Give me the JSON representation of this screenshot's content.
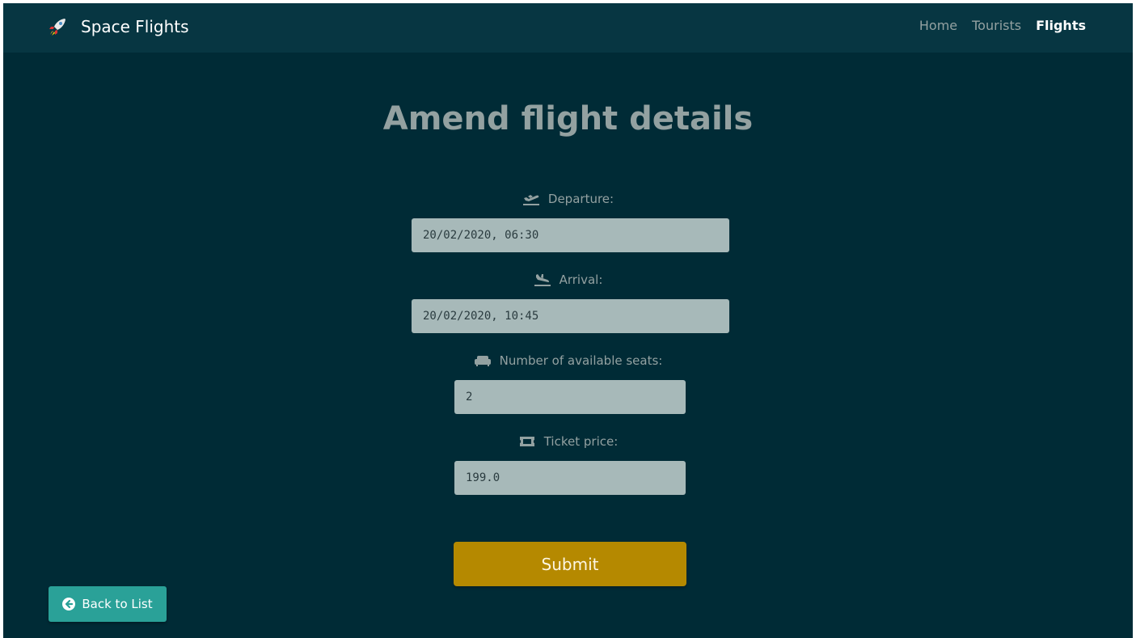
{
  "navbar": {
    "brand": "Space Flights",
    "brand_icon": "rocket-icon",
    "links": [
      "Home",
      "Tourists",
      "Flights"
    ],
    "active_link": "Flights"
  },
  "form": {
    "title": "Amend flight details",
    "departure": {
      "label": "Departure:",
      "value": "20/02/2020, 06:30",
      "icon": "plane-departure-icon"
    },
    "arrival": {
      "label": "Arrival:",
      "value": "20/02/2020, 10:45",
      "icon": "plane-arrival-icon"
    },
    "seats": {
      "label": "Number of available seats:",
      "value": "2",
      "icon": "couch-icon"
    },
    "price": {
      "label": "Ticket price:",
      "value": "199.0",
      "icon": "ticket-icon"
    },
    "submit_label": "Submit"
  },
  "back_button": {
    "label": "Back to List",
    "icon": "arrow-circle-left-icon"
  },
  "colors": {
    "background": "#002b36",
    "navbar": "#073642",
    "submit": "#b58900",
    "back": "#2aa198",
    "input": "#a7b9b9"
  }
}
